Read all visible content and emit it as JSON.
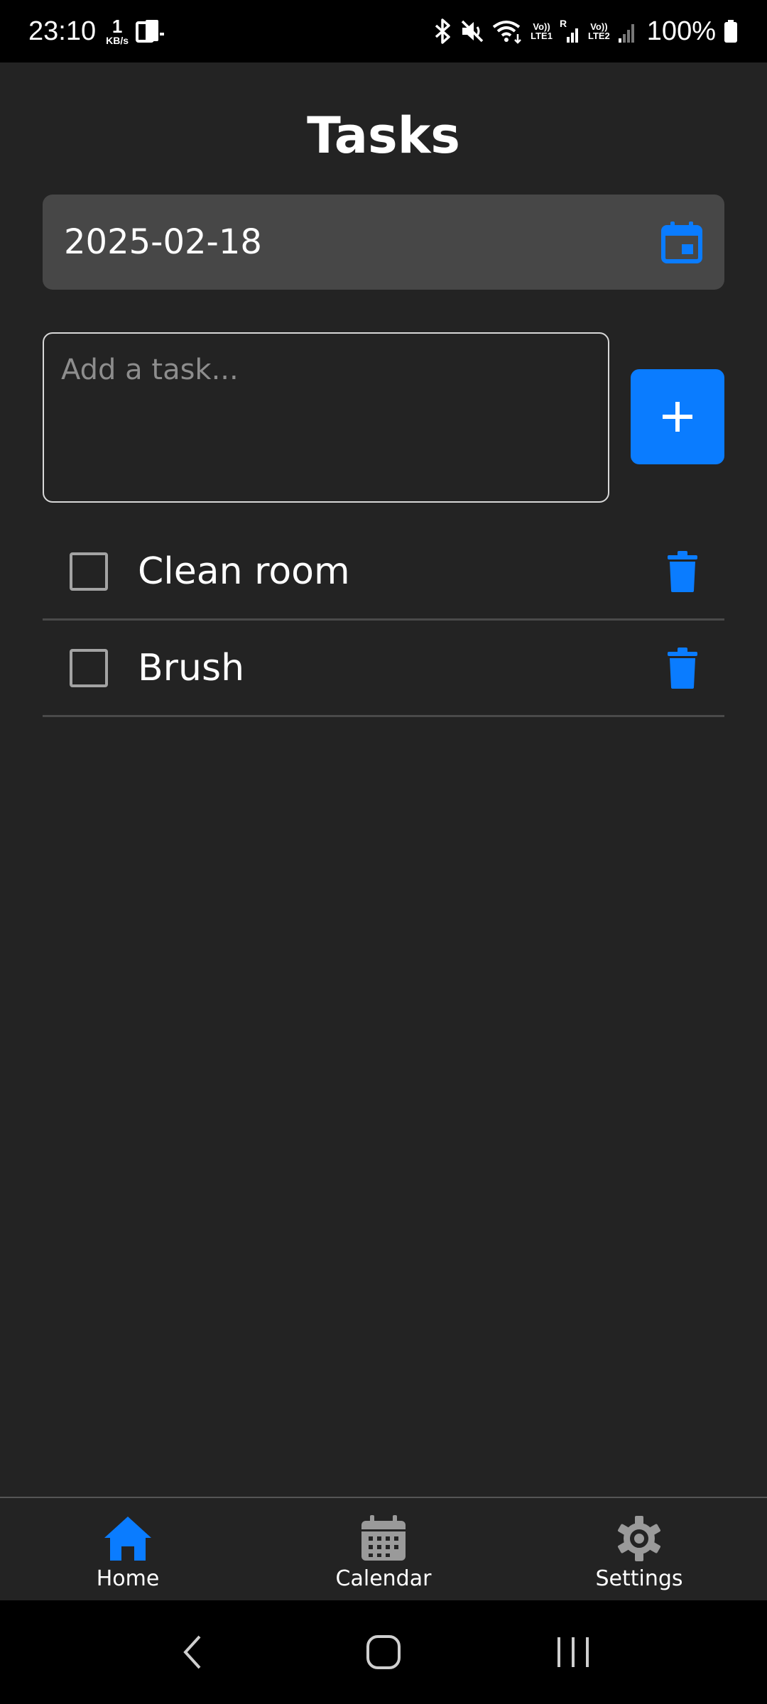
{
  "status_bar": {
    "time": "23:10",
    "net_speed_value": "1",
    "net_speed_unit": "KB/s",
    "battery_percent": "100%",
    "volte1_top": "Vo))",
    "volte1_bottom": "LTE1",
    "roaming": "R",
    "volte2_top": "Vo))",
    "volte2_bottom": "LTE2",
    "icons": [
      "screen-mirror-icon",
      "bluetooth-icon",
      "mute-icon",
      "wifi-icon",
      "signal-icon",
      "battery-icon"
    ]
  },
  "header": {
    "title": "Tasks"
  },
  "date_picker": {
    "value": "2025-02-18",
    "icon": "calendar-icon"
  },
  "task_input": {
    "placeholder": "Add a task...",
    "value": ""
  },
  "add_button": {
    "icon": "plus-icon"
  },
  "tasks": [
    {
      "label": "Clean room",
      "checked": false
    },
    {
      "label": "Brush",
      "checked": false
    }
  ],
  "bottom_nav": {
    "items": [
      {
        "label": "Home",
        "icon": "home-icon",
        "active": true
      },
      {
        "label": "Calendar",
        "icon": "calendar-grid-icon",
        "active": false
      },
      {
        "label": "Settings",
        "icon": "gear-icon",
        "active": false
      }
    ]
  },
  "colors": {
    "accent": "#0a7cff",
    "background": "#232323",
    "surface": "#474747",
    "inactive_icon": "#9a9a9a"
  }
}
